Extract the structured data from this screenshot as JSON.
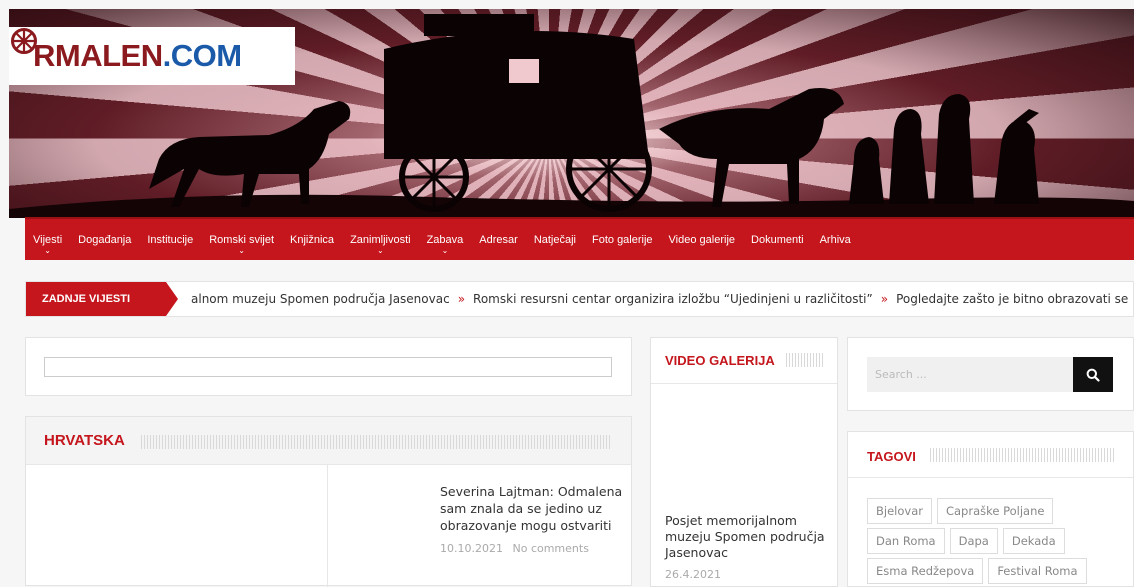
{
  "logo": {
    "part1": "R",
    "part2": "MALEN",
    "part3": ".COM",
    "wheel_icon": "wheel-icon",
    "colors": {
      "red": "#8b1a1f",
      "blue": "#1a5aa8"
    }
  },
  "nav": {
    "items": [
      {
        "label": "Vijesti",
        "has_submenu": true
      },
      {
        "label": "Događanja",
        "has_submenu": false
      },
      {
        "label": "Institucije",
        "has_submenu": false
      },
      {
        "label": "Romski svijet",
        "has_submenu": true
      },
      {
        "label": "Knjižnica",
        "has_submenu": false
      },
      {
        "label": "Zanimljivosti",
        "has_submenu": true
      },
      {
        "label": "Zabava",
        "has_submenu": true
      },
      {
        "label": "Adresar",
        "has_submenu": false
      },
      {
        "label": "Natječaji",
        "has_submenu": false
      },
      {
        "label": "Foto galerije",
        "has_submenu": false
      },
      {
        "label": "Video galerije",
        "has_submenu": false
      },
      {
        "label": "Dokumenti",
        "has_submenu": false
      },
      {
        "label": "Arhiva",
        "has_submenu": false
      }
    ],
    "color": "#c4161c"
  },
  "ticker": {
    "label": "ZADNJE VIJESTI",
    "items": [
      "alnom muzeju Spomen područja Jasenovac",
      "Romski resursni centar organizira izložbu “Ujedinjeni u različitosti”",
      "Pogledajte zašto je bitno obrazovati se i koje su"
    ],
    "separator": "»"
  },
  "main": {
    "hrvatska": {
      "title": "HRVATSKA",
      "article": {
        "title": "Severina Lajtman: Odmalena sam znala da se jedino uz obrazovanje mogu ostvariti",
        "date": "10.10.2021",
        "comments": "No comments"
      }
    }
  },
  "video": {
    "title": "VIDEO GALERIJA",
    "article": {
      "title": "Posjet memorijalnom muzeju Spomen područja Jasenovac",
      "date": "26.4.2021"
    }
  },
  "sidebar": {
    "search": {
      "placeholder": "Search ...",
      "button_icon": "search-icon"
    },
    "tags": {
      "title": "TAGOVI",
      "items": [
        "Bjelovar",
        "Capraške Poljane",
        "Dan Roma",
        "Dapa",
        "Dekada",
        "Esma Redžepova",
        "Festival Roma"
      ]
    }
  }
}
